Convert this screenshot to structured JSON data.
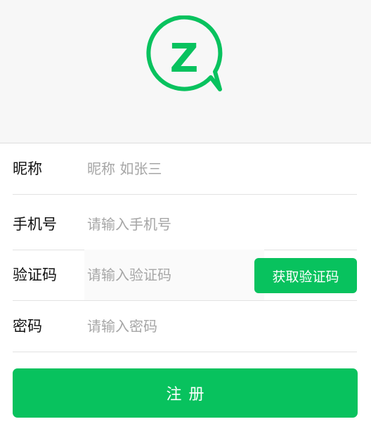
{
  "brand": {
    "logo_icon": "z-chat-bubble-icon",
    "logo_letter": "Z",
    "accent_color": "#08c25e"
  },
  "form": {
    "nickname": {
      "label": "昵称",
      "placeholder": "昵称 如张三",
      "value": ""
    },
    "phone": {
      "label": "手机号",
      "placeholder": "请输入手机号",
      "value": ""
    },
    "code": {
      "label": "验证码",
      "placeholder": "请输入验证码",
      "value": "",
      "button_label": "获取验证码"
    },
    "password": {
      "label": "密码",
      "placeholder": "请输入密码",
      "value": ""
    },
    "submit_label": "注册"
  }
}
